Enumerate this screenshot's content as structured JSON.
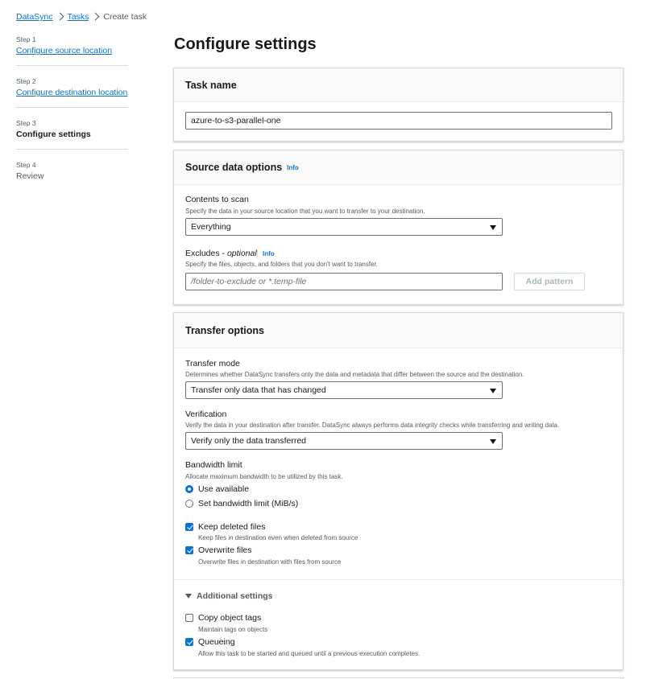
{
  "breadcrumb": {
    "root": "DataSync",
    "tasks": "Tasks",
    "current": "Create task"
  },
  "steps": [
    {
      "num": "Step 1",
      "label": "Configure source location"
    },
    {
      "num": "Step 2",
      "label": "Configure destination location"
    },
    {
      "num": "Step 3",
      "label": "Configure settings"
    },
    {
      "num": "Step 4",
      "label": "Review"
    }
  ],
  "page_title": "Configure settings",
  "task_name": {
    "heading": "Task name",
    "value": "azure-to-s3-parallel-one"
  },
  "source_options": {
    "heading": "Source data options",
    "info": "Info",
    "contents_label": "Contents to scan",
    "contents_desc": "Specify the data in your source location that you want to transfer to your destination.",
    "contents_value": "Everything",
    "excludes_label": "Excludes - ",
    "excludes_optional": "optional",
    "excludes_info": "Info",
    "excludes_desc": "Specify the files, objects, and folders that you don't want to transfer.",
    "excludes_placeholder": "/folder-to-exclude or *.temp-file",
    "add_pattern": "Add pattern"
  },
  "transfer_options": {
    "heading": "Transfer options",
    "mode_label": "Transfer mode",
    "mode_desc": "Determines whether DataSync transfers only the data and metadata that differ between the source and the destination.",
    "mode_value": "Transfer only data that has changed",
    "verification_label": "Verification",
    "verification_desc": "Verify the data in your destination after transfer. DataSync always performs data integrity checks while transferring and writing data.",
    "verification_value": "Verify only the data transferred",
    "bandwidth_label": "Bandwidth limit",
    "bandwidth_desc": "Allocate maximum bandwidth to be utilized by this task.",
    "bandwidth_use_available": "Use available",
    "bandwidth_set_limit": "Set bandwidth limit (MiB/s)",
    "keep_deleted_label": "Keep deleted files",
    "keep_deleted_desc": "Keep files in destination even when deleted from source",
    "overwrite_label": "Overwrite files",
    "overwrite_desc": "Overwrite files in destination with files from source",
    "additional_settings": "Additional settings",
    "copy_tags_label": "Copy object tags",
    "copy_tags_desc": "Maintain tags on objects",
    "queueing_label": "Queueing",
    "queueing_desc": "Allow this task to be started and queued until a previous execution completes."
  },
  "colors": {
    "link": "#0972d3",
    "text": "#16191f",
    "muted": "#545b64"
  }
}
